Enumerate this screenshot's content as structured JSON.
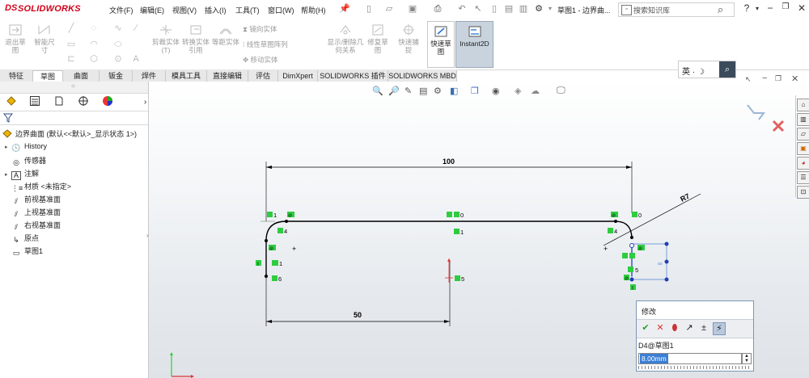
{
  "app": {
    "brand_ds": "DS",
    "brand": "SOLIDWORKS",
    "doc_title": "草图1 - 边界曲...",
    "search_placeholder": "搜索知识库"
  },
  "menu": [
    "文件(F)",
    "编辑(E)",
    "视图(V)",
    "插入(I)",
    "工具(T)",
    "窗口(W)",
    "帮助(H)"
  ],
  "ribbon": {
    "exit_sketch": "退出草图",
    "smart_dim": "智能尺寸",
    "trim": "剪裁实体(T)",
    "convert": "转换实体引用",
    "offset": "等距实体",
    "mirror": "镜向实体",
    "linear_pattern": "线性草图阵列",
    "move": "移动实体",
    "display_delete": "显示/删除几何关系",
    "repair": "修复草图",
    "quick_snap": "快速捕捉",
    "quick_sketch": "快速草图",
    "instant2d": "Instant2D"
  },
  "tabs": [
    "特征",
    "草图",
    "曲面",
    "钣金",
    "焊件",
    "模具工具",
    "直接编辑",
    "评估",
    "DimXpert",
    "SOLIDWORKS 插件",
    "SOLIDWORKS MBD"
  ],
  "active_tab": "草图",
  "tree": {
    "root": "边界曲面  (默认<<默认>_显示状态 1>)",
    "items": [
      {
        "label": "History",
        "expand": "▸"
      },
      {
        "label": "传感器",
        "expand": ""
      },
      {
        "label": "注解",
        "expand": "▸"
      },
      {
        "label": "材质 <未指定>",
        "expand": ""
      },
      {
        "label": "前视基准面",
        "expand": ""
      },
      {
        "label": "上视基准面",
        "expand": ""
      },
      {
        "label": "右视基准面",
        "expand": ""
      },
      {
        "label": "原点",
        "expand": ""
      },
      {
        "label": "草图1",
        "expand": ""
      }
    ]
  },
  "floating_input": "英 · ☽",
  "sketch": {
    "dim_top": "100",
    "dim_bottom": "50",
    "dim_radius": "R7",
    "rel_labels": [
      "1",
      "0",
      "0",
      "0",
      "1",
      "4",
      "4",
      "1",
      "1",
      "5",
      "5",
      "6",
      "6"
    ]
  },
  "modify": {
    "title": "修改",
    "dim_name": "D4@草图1",
    "value": "8.00mm"
  },
  "colors": {
    "accent": "#3b7fd6",
    "brand_red": "#d0021b",
    "relation_green": "#2ecc40",
    "sketch_blue": "#1f3fb6"
  }
}
